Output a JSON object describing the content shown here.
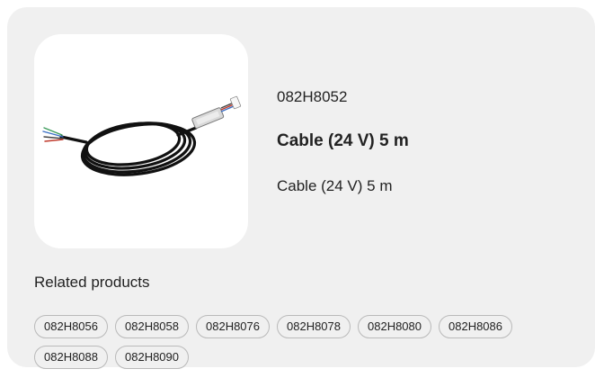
{
  "product": {
    "image_icon": "cable-product-image",
    "code": "082H8052",
    "title": "Cable (24 V) 5 m",
    "description": "Cable (24 V) 5 m"
  },
  "related": {
    "heading": "Related products",
    "items": [
      "082H8056",
      "082H8058",
      "082H8076",
      "082H8078",
      "082H8080",
      "082H8086",
      "082H8088",
      "082H8090"
    ]
  },
  "colors": {
    "card_background": "#f0f0f0",
    "chip_border": "#b9b9b9",
    "text": "#222222"
  }
}
